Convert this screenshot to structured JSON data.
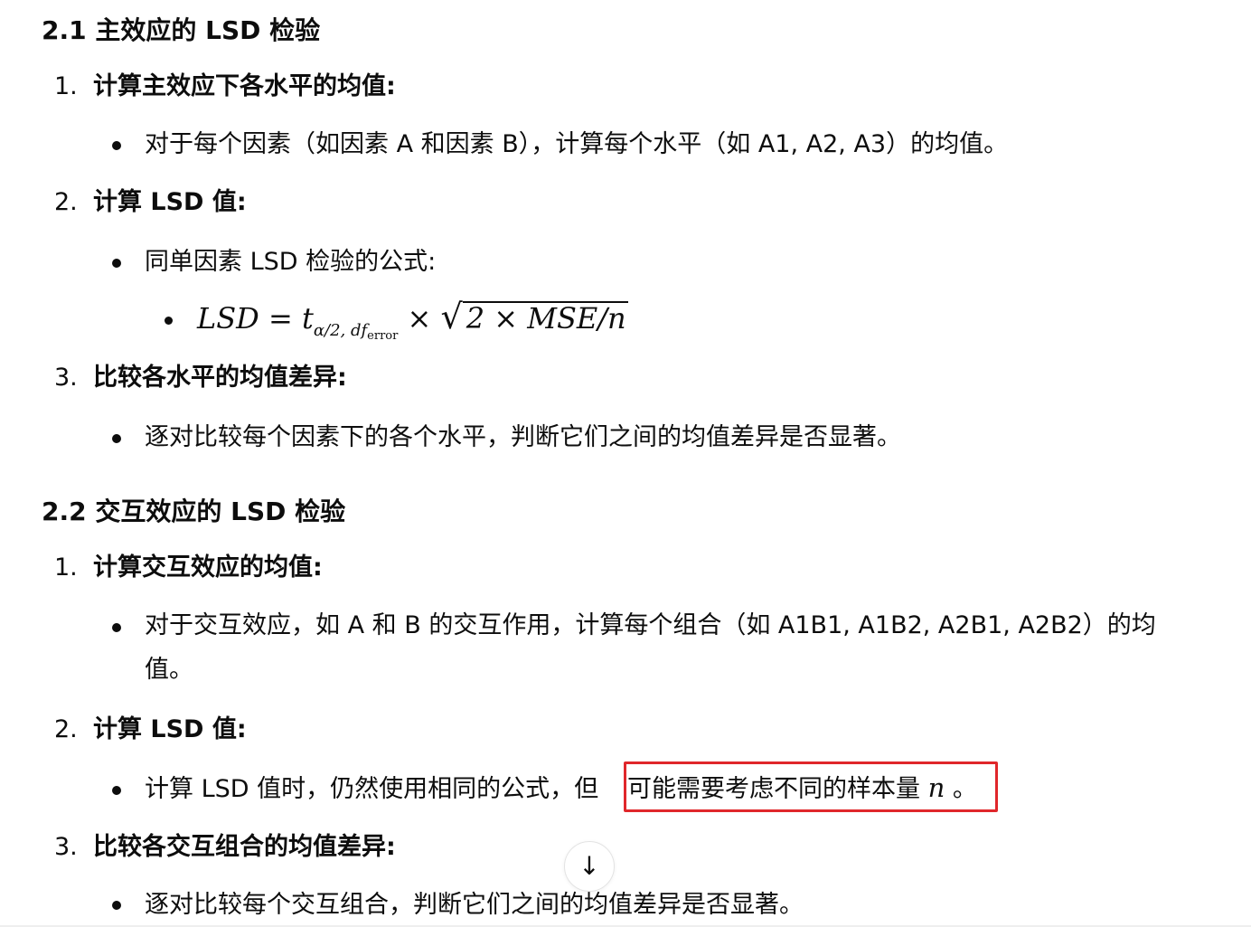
{
  "section1": {
    "title": "2.1 主效应的 LSD 检验",
    "steps": [
      {
        "num": "1.",
        "title": "计算主效应下各水平的均值:",
        "bullet": "对于每个因素（如因素 A 和因素 B），计算每个水平（如 A1, A2, A3）的均值。"
      },
      {
        "num": "2.",
        "title": "计算 LSD 值:",
        "bullet": "同单因素 LSD 检验的公式:"
      },
      {
        "num": "3.",
        "title": "比较各水平的均值差异:",
        "bullet": "逐对比较每个因素下的各个水平，判断它们之间的均值差异是否显著。"
      }
    ],
    "formula": {
      "lhs": "LSD",
      "eq": "=",
      "t": "t",
      "sub_main": "α/2, df",
      "sub_sub": "error",
      "times": "×",
      "radicand": "2 × MSE/n"
    }
  },
  "section2": {
    "title": "2.2 交互效应的 LSD 检验",
    "steps": [
      {
        "num": "1.",
        "title": "计算交互效应的均值:",
        "bullet_line1": "对于交互效应，如 A 和 B 的交互作用，计算每个组合（如 A1B1, A1B2, A2B1, A2B2）的均",
        "bullet_line2": "值。"
      },
      {
        "num": "2.",
        "title": "计算 LSD 值:",
        "bullet_before": "计算 LSD 值时，仍然使用相同的公式，但",
        "bullet_highlight": "可能需要考虑不同的样本量",
        "bullet_var": "n",
        "bullet_end": "。"
      },
      {
        "num": "3.",
        "title": "比较各交互组合的均值差异:",
        "bullet": "逐对比较每个交互组合，判断它们之间的均值差异是否显著。"
      }
    ]
  },
  "scroll_button": {
    "icon": "arrow-down-icon",
    "glyph": "↓"
  },
  "colors": {
    "highlight_border": "#e0272b",
    "text": "#0d0d0d"
  }
}
